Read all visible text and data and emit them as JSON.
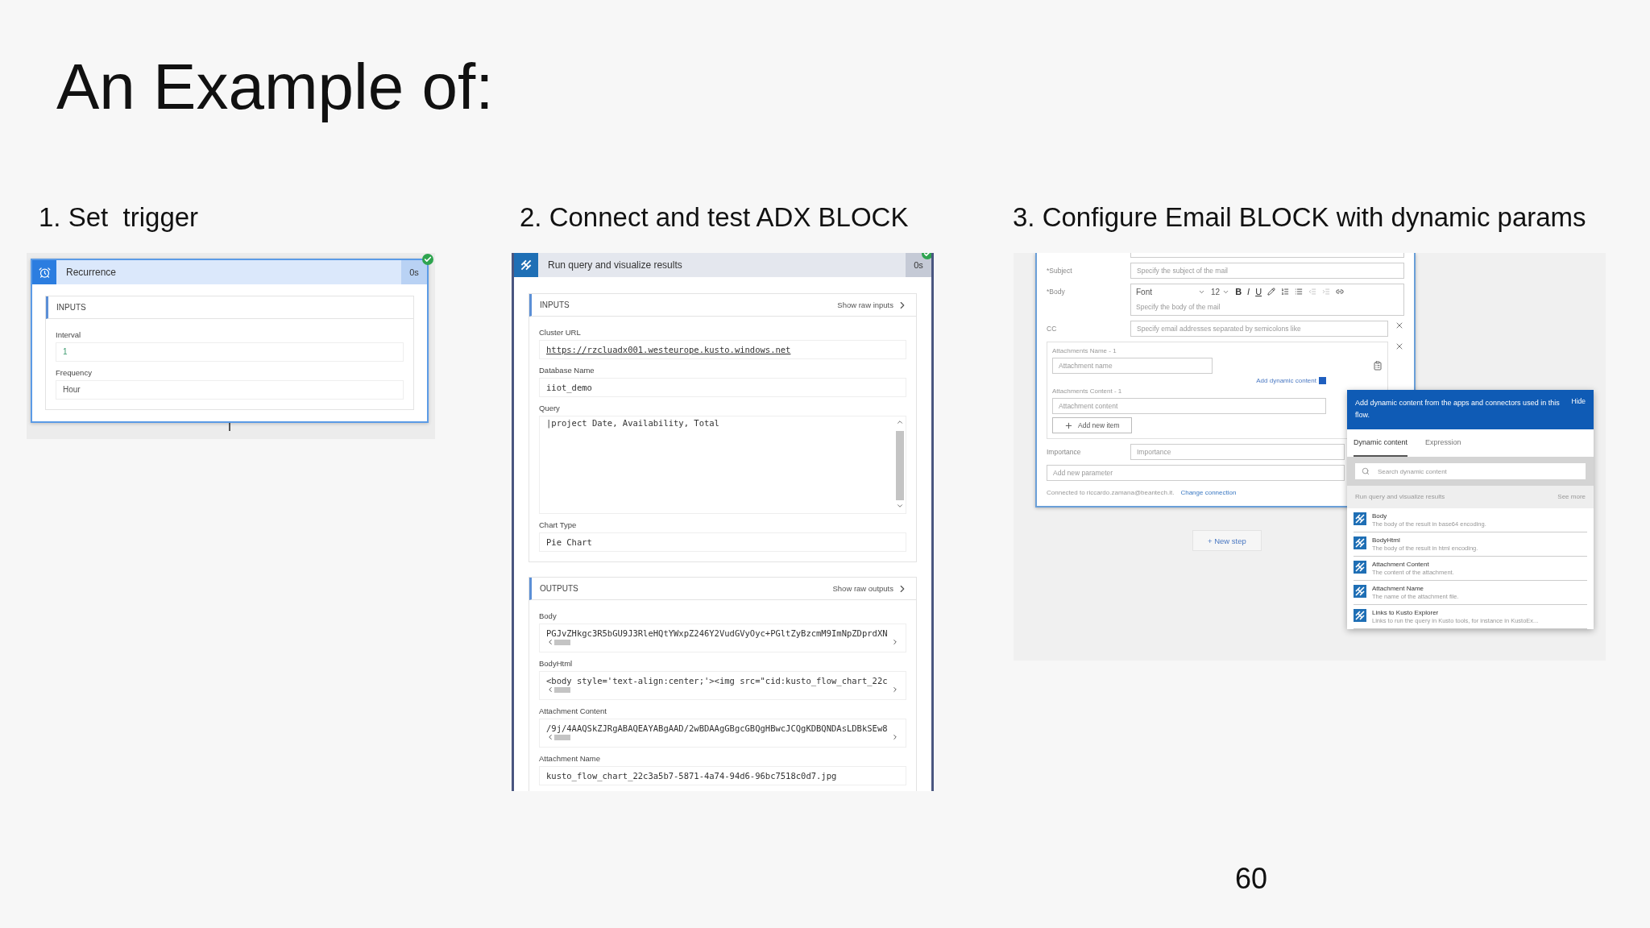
{
  "title": "An Example of:",
  "step1": {
    "heading": "1. Set  trigger",
    "card": {
      "title": "Recurrence",
      "duration": "0s",
      "succeeded": true,
      "section": "INPUTS",
      "fields": [
        {
          "label": "Interval",
          "value": "1",
          "kind": "number"
        },
        {
          "label": "Frequency",
          "value": "Hour",
          "kind": "text"
        }
      ]
    }
  },
  "step2": {
    "heading": "2. Connect and test ADX BLOCK",
    "card": {
      "title": "Run query and visualize results",
      "duration": "0s",
      "succeeded": true,
      "inputs": {
        "header": "INPUTS",
        "action": "Show raw inputs",
        "fields": [
          {
            "label": "Cluster URL",
            "value": "https://rzcluadx001.westeurope.kusto.windows.net",
            "kind": "link"
          },
          {
            "label": "Database Name",
            "value": "iiot_demo",
            "kind": "text"
          },
          {
            "label": "Query",
            "value": "|project Date, Availability, Total",
            "kind": "textarea"
          },
          {
            "label": "Chart Type",
            "value": "Pie Chart",
            "kind": "text"
          }
        ]
      },
      "outputs": {
        "header": "OUTPUTS",
        "action": "Show raw outputs",
        "fields": [
          {
            "label": "Body",
            "value": "PGJvZHkgc3R5bGU9J3RleHQtYWxpZ246Y2VudGVyOyc+PGltZyBzcmM9ImNpZDprdXN",
            "kind": "scroll"
          },
          {
            "label": "BodyHtml",
            "value": "<body style='text-align:center;'><img src=\"cid:kusto_flow_chart_22c",
            "kind": "scroll"
          },
          {
            "label": "Attachment Content",
            "value": "/9j/4AAQSkZJRgABAQEAYABgAAD/2wBDAAgGBgcGBQgHBwcJCQgKDBQNDAsLDBkSEw8",
            "kind": "scroll"
          },
          {
            "label": "Attachment Name",
            "value": "kusto_flow_chart_22c3a5b7-5871-4a74-94d6-96bc7518c0d7.jpg",
            "kind": "text"
          }
        ]
      }
    }
  },
  "step3": {
    "heading": "3. Configure Email BLOCK with dynamic params",
    "email": {
      "subject": {
        "label": "*Subject",
        "placeholder": "Specify the subject of the mail"
      },
      "body": {
        "label": "*Body",
        "font": "Font",
        "size": "12",
        "format_buttons": [
          {
            "label": "B",
            "kind": "bold"
          },
          {
            "label": "I",
            "kind": "italic"
          },
          {
            "label": "U",
            "kind": "underline"
          }
        ],
        "placeholder": "Specify the body of the mail"
      },
      "cc": {
        "label": "CC",
        "placeholder": "Specify email addresses separated by semicolons like"
      },
      "attachments": {
        "name_label": "Attachments Name - 1",
        "name_placeholder": "Attachment name",
        "dynamic_link": "Add dynamic content",
        "content_label": "Attachments Content - 1",
        "content_placeholder": "Attachment content",
        "add_button": "Add new item"
      },
      "importance": {
        "label": "Importance",
        "placeholder": "Importance"
      },
      "add_parameter": {
        "placeholder": "Add new parameter"
      },
      "connection": {
        "text": "Connected to riccardo.zamana@beantech.it.",
        "link": "Change connection"
      }
    },
    "new_step": "+ New step",
    "dynamic_panel": {
      "message": "Add dynamic content from the apps and connectors used in this flow.",
      "hide": "Hide",
      "tabs": [
        {
          "label": "Dynamic content",
          "selected": true
        },
        {
          "label": "Expression",
          "selected": false
        }
      ],
      "search": {
        "placeholder": "Search dynamic content"
      },
      "group": {
        "title": "Run query and visualize results",
        "more": "See more"
      },
      "items": [
        {
          "title": "Body",
          "description": "The body of the result in base64 encoding."
        },
        {
          "title": "BodyHtml",
          "description": "The body of the result in html encoding."
        },
        {
          "title": "Attachment Content",
          "description": "The content of the attachment."
        },
        {
          "title": "Attachment Name",
          "description": "The name of the attachment file."
        },
        {
          "title": "Links to Kusto Explorer",
          "description": "Links to run the query in Kusto tools, for instance in KustoEx..."
        }
      ]
    }
  },
  "page_number": "60"
}
